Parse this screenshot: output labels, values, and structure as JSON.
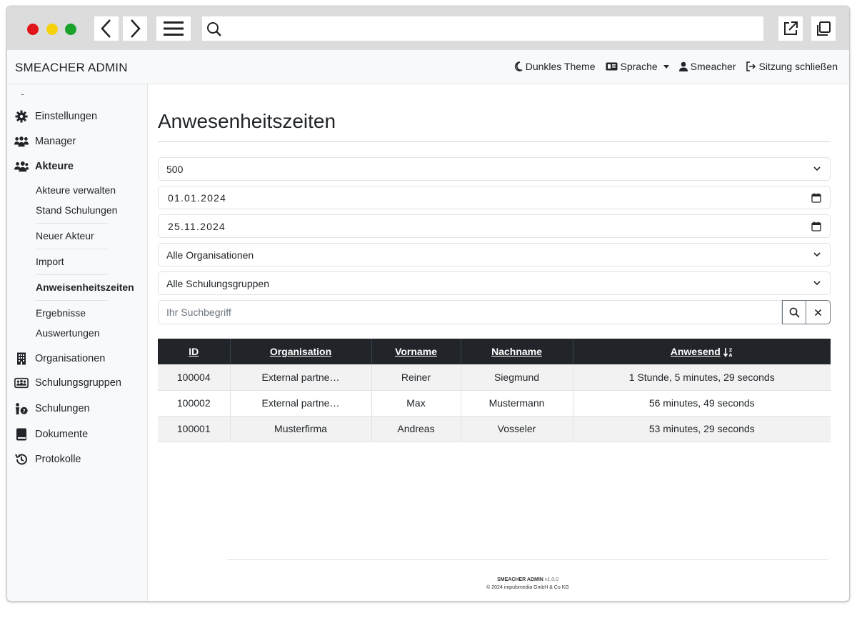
{
  "app": {
    "brand": "SMEACHER ADMIN"
  },
  "navbar": {
    "items": [
      {
        "label": "Dunkles Theme",
        "icon": "moon-icon"
      },
      {
        "label": "Sprache",
        "icon": "language-card-icon"
      },
      {
        "label": "Smeacher",
        "icon": "user-icon"
      },
      {
        "label": "Sitzung schließen",
        "icon": "logout-icon"
      }
    ]
  },
  "sidebar": {
    "items": [
      {
        "label": "Einstellungen",
        "icon": "gear-icon"
      },
      {
        "label": "Manager",
        "icon": "users-icon"
      },
      {
        "label": "Akteure",
        "icon": "people-group-icon"
      },
      {
        "label": "Organisationen",
        "icon": "building-icon"
      },
      {
        "label": "Schulungsgruppen",
        "icon": "people-card-icon"
      },
      {
        "label": "Schulungen",
        "icon": "person-question-icon"
      },
      {
        "label": "Dokumente",
        "icon": "book-icon"
      },
      {
        "label": "Protokolle",
        "icon": "history-icon"
      }
    ],
    "subitems": [
      {
        "label": "Akteure verwalten"
      },
      {
        "label": "Stand Schulungen"
      },
      {
        "label": "Neuer Akteur"
      },
      {
        "label": "Import"
      },
      {
        "label": "Anweisenheitszeiten"
      },
      {
        "label": "Ergebnisse"
      },
      {
        "label": "Auswertungen"
      }
    ]
  },
  "main": {
    "title": "Anwesenheitszeiten",
    "filters": {
      "limit": "500",
      "date_from": "01.01.2024",
      "date_to": "25.11.2024",
      "organisation": "Alle Organisationen",
      "group": "Alle Schulungsgruppen"
    },
    "search": {
      "placeholder": "Ihr Suchbegriff"
    },
    "table": {
      "headers": [
        "ID",
        "Organisation",
        "Vorname",
        "Nachname",
        "Anwesend"
      ],
      "rows": [
        [
          "100004",
          "External partne…",
          "Reiner",
          "Siegmund",
          "1 Stunde, 5 minutes, 29 seconds"
        ],
        [
          "100002",
          "External partne…",
          "Max",
          "Mustermann",
          "56 minutes, 49 seconds"
        ],
        [
          "100001",
          "Musterfirma",
          "Andreas",
          "Vosseler",
          "53 minutes, 29 seconds"
        ]
      ]
    }
  },
  "footer": {
    "app": "SMEACHER ADMIN",
    "version": "v1.0.0",
    "copyright": "© 2024 impulsmedia GmbH & Co KG"
  },
  "colors": {
    "table_header_bg": "#212529",
    "chrome_bg": "#dcdcdc",
    "traffic_red": "#e0141a",
    "traffic_yellow": "#f5d20c",
    "traffic_green": "#19a32a"
  }
}
